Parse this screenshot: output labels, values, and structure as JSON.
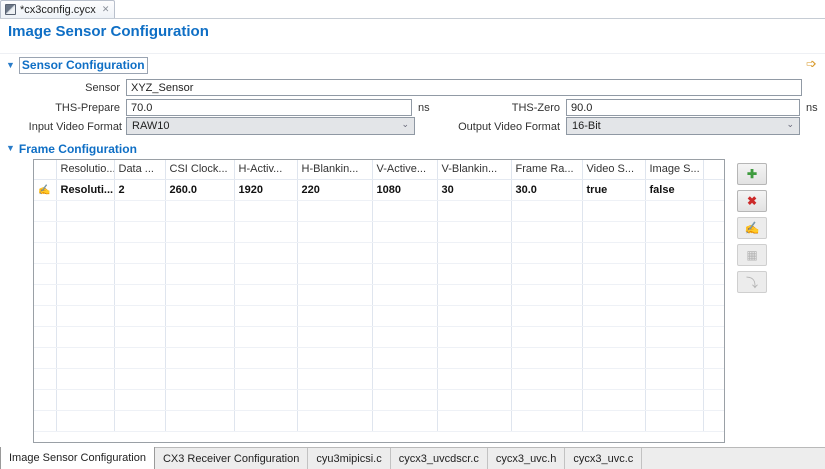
{
  "editor_tab": {
    "title": "*cx3config.cycx",
    "close_glyph": "✕"
  },
  "page_title": "Image Sensor Configuration",
  "sensor_section": {
    "title": "Sensor Configuration",
    "sensor_label": "Sensor",
    "sensor_value": "XYZ_Sensor",
    "ths_prepare_label": "THS-Prepare",
    "ths_prepare_value": "70.0",
    "ths_prepare_unit": "ns",
    "ths_zero_label": "THS-Zero",
    "ths_zero_value": "90.0",
    "ths_zero_unit": "ns",
    "input_format_label": "Input Video Format",
    "input_format_value": "RAW10",
    "output_format_label": "Output Video Format",
    "output_format_value": "16-Bit"
  },
  "frame_section": {
    "title": "Frame Configuration",
    "columns": [
      "Resolutio...",
      "Data ...",
      "CSI Clock...",
      "H-Activ...",
      "H-Blankin...",
      "V-Active...",
      "V-Blankin...",
      "Frame Ra...",
      "Video S...",
      "Image S..."
    ],
    "row1": [
      "Resoluti...",
      "2",
      "260.0",
      "1920",
      "220",
      "1080",
      "30",
      "30.0",
      "true",
      "false"
    ]
  },
  "side_buttons": {
    "add_glyph": "✚",
    "delete_glyph": "✖",
    "edit_glyph": "✍",
    "copy_glyph": "▦",
    "move_glyph": "⤵"
  },
  "colors": {
    "accent_blue": "#0f6fc5",
    "add_green": "#3e9b3e",
    "delete_red": "#cc2a2a",
    "goto_yellow": "#d99a2b"
  },
  "bottom_tabs": [
    "Image Sensor Configuration",
    "CX3 Receiver Configuration",
    "cyu3mipicsi.c",
    "cycx3_uvcdscr.c",
    "cycx3_uvc.h",
    "cycx3_uvc.c"
  ]
}
